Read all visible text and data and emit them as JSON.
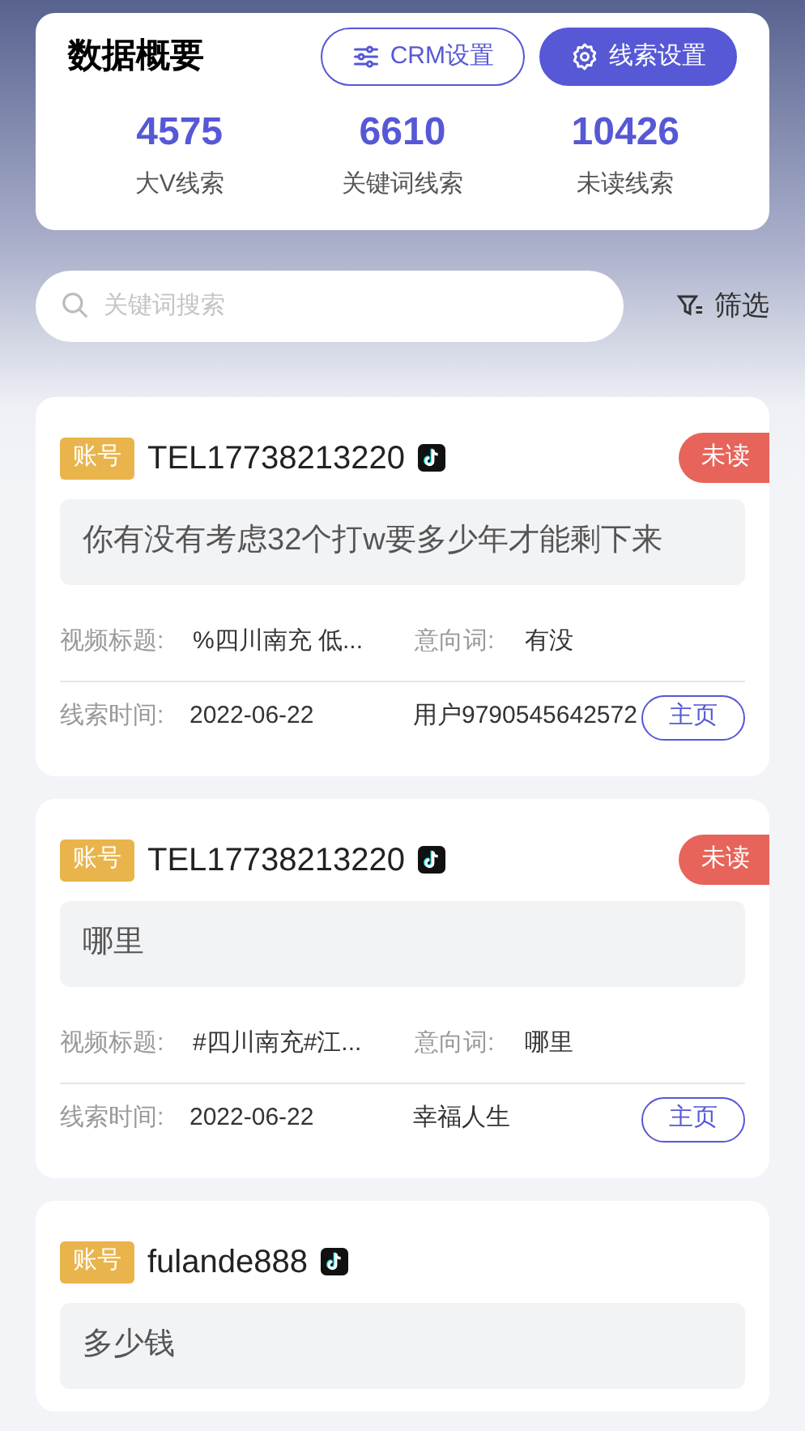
{
  "summary": {
    "title": "数据概要",
    "buttons": [
      {
        "label": "CRM设置",
        "kind": "outline"
      },
      {
        "label": "线索设置",
        "kind": "filled"
      }
    ],
    "stats": [
      {
        "value": "4575",
        "label": "大V线索"
      },
      {
        "value": "6610",
        "label": "关键词线索"
      },
      {
        "value": "10426",
        "label": "未读线索"
      }
    ]
  },
  "search": {
    "placeholder": "关键词搜索"
  },
  "filter": {
    "label": "筛选"
  },
  "leads": [
    {
      "tag": "账号",
      "account": "TEL17738213220",
      "unread": true,
      "badge": "未读",
      "comment": "你有没有考虑32个打w要多少年才能剩下来",
      "video_label": "视频标题:",
      "video_title": "%四川南充 低...",
      "intent_label": "意向词:",
      "intent": "有没",
      "time_label": "线索时间:",
      "time": "2022-06-22",
      "user": "用户9790545642572",
      "home": "主页"
    },
    {
      "tag": "账号",
      "account": "TEL17738213220",
      "unread": true,
      "badge": "未读",
      "comment": "哪里",
      "video_label": "视频标题:",
      "video_title": "#四川南充#江...",
      "intent_label": "意向词:",
      "intent": "哪里",
      "time_label": "线索时间:",
      "time": "2022-06-22",
      "user": "幸福人生",
      "home": "主页"
    },
    {
      "tag": "账号",
      "account": "fulande888",
      "unread": false,
      "comment": "多少钱"
    }
  ]
}
